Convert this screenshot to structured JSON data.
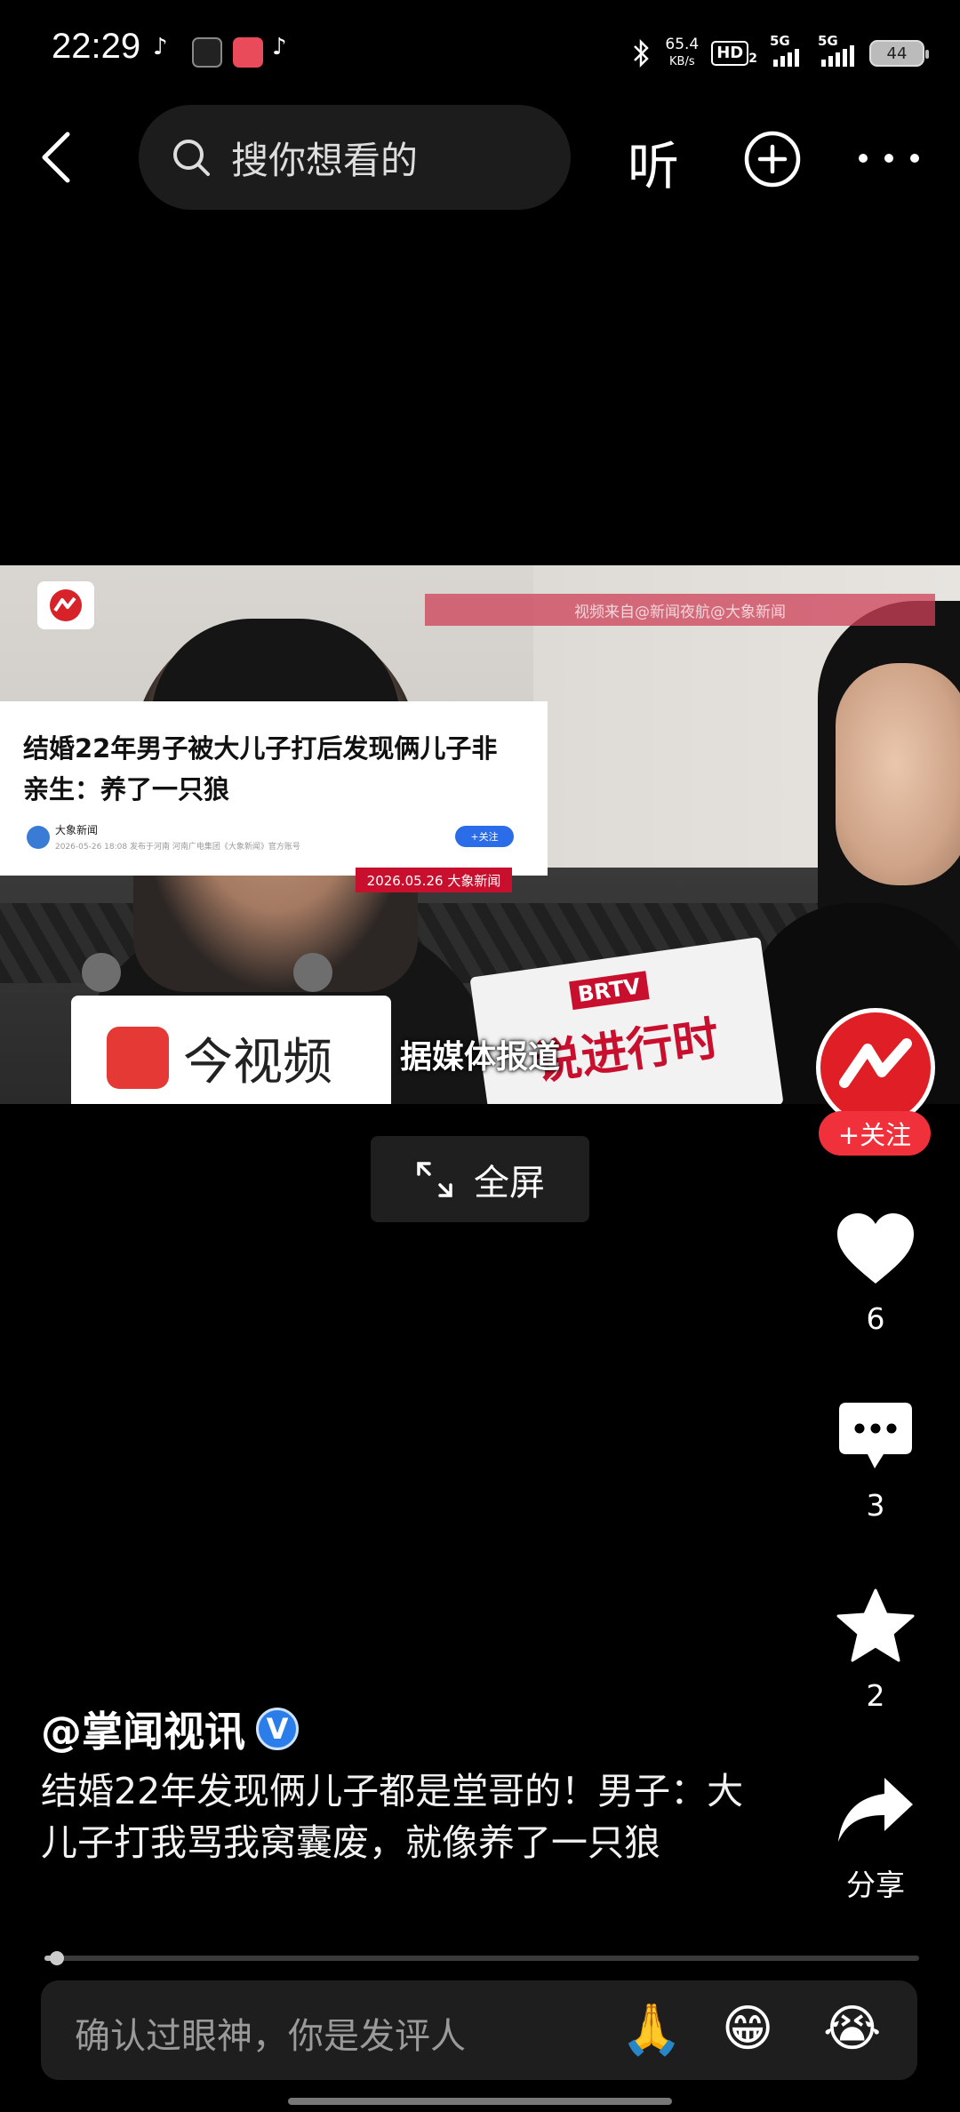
{
  "status_bar": {
    "time": "22:29",
    "net_speed_value": "65.4",
    "net_speed_unit": "KB/s",
    "hd_label": "HD",
    "hd_sub": "2",
    "signal1_label": "5G",
    "signal2_label": "5G",
    "battery": "44"
  },
  "nav": {
    "search_placeholder": "搜你想看的",
    "listen_label": "听"
  },
  "video": {
    "source_text": "视频来自@新闻夜航@大象新闻",
    "news_headline": "结婚22年男子被大儿子打后发现俩儿子非亲生：养了一只狼",
    "news_source_name": "大象新闻",
    "news_source_meta": "2026-05-26 18:08  发布于河南  河南广电集团《大象新闻》官方账号",
    "news_follow_label": "+关注",
    "date_tag": "2026.05.26 大象新闻",
    "sign_left": "今视频",
    "sign_right_brand": "BRTV",
    "sign_right_text": "说进行时",
    "subtitle": "据媒体报道"
  },
  "fullscreen_label": "全屏",
  "rail": {
    "follow_label": "+关注",
    "like_count": "6",
    "comment_count": "3",
    "favorite_count": "2",
    "share_label": "分享"
  },
  "caption": {
    "author": "@掌闻视讯",
    "verified_mark": "V",
    "description": "结婚22年发现俩儿子都是堂哥的！男子：大儿子打我骂我窝囊废，就像养了一只狼"
  },
  "progress": {
    "fraction": 0.007
  },
  "comment": {
    "placeholder": "确认过眼神，你是发评人",
    "emojis": [
      "🙏",
      "😁",
      "😭"
    ]
  },
  "colors": {
    "accent_red": "#f0313c",
    "verified_blue": "#2b7de9",
    "background": "#000000"
  }
}
